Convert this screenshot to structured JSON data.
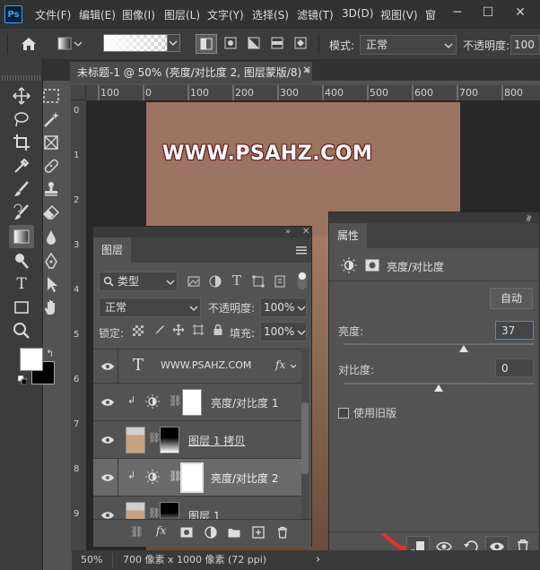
{
  "app": {
    "logo": "Ps"
  },
  "menu": [
    "文件(F)",
    "编辑(E)",
    "图像(I)",
    "图层(L)",
    "文字(Y)",
    "选择(S)",
    "滤镜(T)",
    "3D(D)",
    "视图(V)",
    "窗"
  ],
  "window_controls": [
    "─",
    "☐",
    "✕"
  ],
  "options_bar": {
    "mode_label": "模式:",
    "mode_value": "正常",
    "opacity_label": "不透明度:",
    "opacity_value": "100"
  },
  "document": {
    "tab_title": "未标题-1 @ 50% (亮度/对比度 2, 图层蒙版/8) *",
    "close": "✕",
    "watermark": "WWW.PSAHZ.COM",
    "ruler_labels": [
      "100",
      "0",
      "100",
      "200",
      "300",
      "400",
      "500",
      "600",
      "700",
      "800"
    ],
    "ruler_v_labels": [
      "0",
      "1",
      "2",
      "3",
      "4",
      "5",
      "6",
      "7",
      "8",
      "9"
    ]
  },
  "status": {
    "zoom": "50%",
    "size": "700 像素 x 1000 像素 (72 ppi)",
    "arrow": "›"
  },
  "layers_panel": {
    "tab": "图层",
    "filter_label": "类型",
    "blend_mode": "正常",
    "opacity_label": "不透明度:",
    "opacity_value": "100%",
    "lock_label": "锁定:",
    "fill_label": "填充:",
    "fill_value": "100%",
    "layers": [
      {
        "name": "WWW.PSAHZ.COM",
        "type": "text",
        "fx": "fx"
      },
      {
        "name": "亮度/对比度 1",
        "type": "adjustment"
      },
      {
        "name": "图层 1 拷贝",
        "type": "image"
      },
      {
        "name": "亮度/对比度 2",
        "type": "adjustment",
        "selected": true
      },
      {
        "name": "图层 1",
        "type": "image"
      }
    ],
    "footer_fx": "fx"
  },
  "properties_panel": {
    "tab": "属性",
    "title": "亮度/对比度",
    "auto_button": "自动",
    "brightness_label": "亮度:",
    "brightness_value": "37",
    "contrast_label": "对比度:",
    "contrast_value": "0",
    "legacy_label": "使用旧版",
    "brightness_fraction": 0.63,
    "contrast_fraction": 0.5
  },
  "colors": {
    "accent": "#31a8ff",
    "canvas": "#9b7462",
    "panel": "#535353",
    "arrow": "#e8302a"
  }
}
